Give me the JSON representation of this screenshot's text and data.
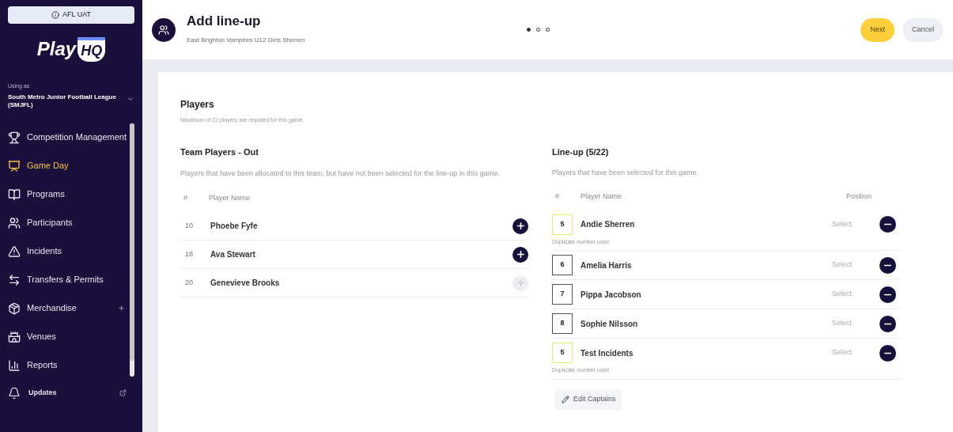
{
  "sidebar": {
    "env_badge": "AFL UAT",
    "logo": {
      "word": "Play",
      "mark": "HQ"
    },
    "using_as_label": "Using as",
    "organisation": "South Metro Junior Football League (SMJFL)",
    "items": [
      {
        "kind": "trophy",
        "label": "Competition Management",
        "selected": false,
        "expandable": false
      },
      {
        "kind": "gameday",
        "label": "Game Day",
        "selected": true,
        "expandable": false
      },
      {
        "kind": "book",
        "label": "Programs",
        "selected": false,
        "expandable": false
      },
      {
        "kind": "people",
        "label": "Participants",
        "selected": false,
        "expandable": false
      },
      {
        "kind": "alert",
        "label": "Incidents",
        "selected": false,
        "expandable": false
      },
      {
        "kind": "transfer",
        "label": "Transfers & Permits",
        "selected": false,
        "expandable": false
      },
      {
        "kind": "package",
        "label": "Merchandise",
        "selected": false,
        "expandable": true
      },
      {
        "kind": "venue",
        "label": "Venues",
        "selected": false,
        "expandable": false
      },
      {
        "kind": "reports",
        "label": "Reports",
        "selected": false,
        "expandable": false
      }
    ],
    "footer": [
      {
        "kind": "updates",
        "label": "Updates"
      }
    ]
  },
  "header": {
    "title": "Add line-up",
    "subtitle": "East Brighton Vampires U12 Girls Sherren",
    "steps": [
      {
        "selected": true
      },
      {
        "selected": false
      },
      {
        "selected": false
      }
    ],
    "buttons": [
      {
        "kind": "primary",
        "label": "Next"
      },
      {
        "kind": "secondary",
        "label": "Cancel"
      }
    ]
  },
  "players": {
    "title": "Players",
    "note": "Maximum of 22 players are required for this game.",
    "out": {
      "title": "Team Players - Out",
      "description": "Players that have been allocated to this team, but have not been selected for the line-up in this game.",
      "columns": [
        "#",
        "Player Name"
      ],
      "rows": [
        {
          "number": "10",
          "name": "Phoebe Fyfe",
          "disabled": false
        },
        {
          "number": "18",
          "name": "Ava Stewart",
          "disabled": false
        },
        {
          "number": "20",
          "name": "Genevieve Brooks",
          "disabled": true
        }
      ]
    },
    "lineup": {
      "title": "Line-up (5/22)",
      "description": "Players that have been selected for this game.",
      "columns": [
        "#",
        "Player Name",
        "Position"
      ],
      "rows": [
        {
          "number": "5",
          "name": "Andie Sherren",
          "position": "Select",
          "duplicate": true,
          "warning": "Duplicate number used"
        },
        {
          "number": "6",
          "name": "Amelia Harris",
          "position": "Select",
          "duplicate": false
        },
        {
          "number": "7",
          "name": "Pippa Jacobson",
          "position": "Select",
          "duplicate": false
        },
        {
          "number": "8",
          "name": "Sophie Nilsson",
          "position": "Select",
          "duplicate": false
        },
        {
          "number": "5",
          "name": "Test Incidents",
          "position": "Select",
          "duplicate": true,
          "warning": "Duplicate number used"
        }
      ],
      "edit_button": "Edit Captains"
    }
  }
}
